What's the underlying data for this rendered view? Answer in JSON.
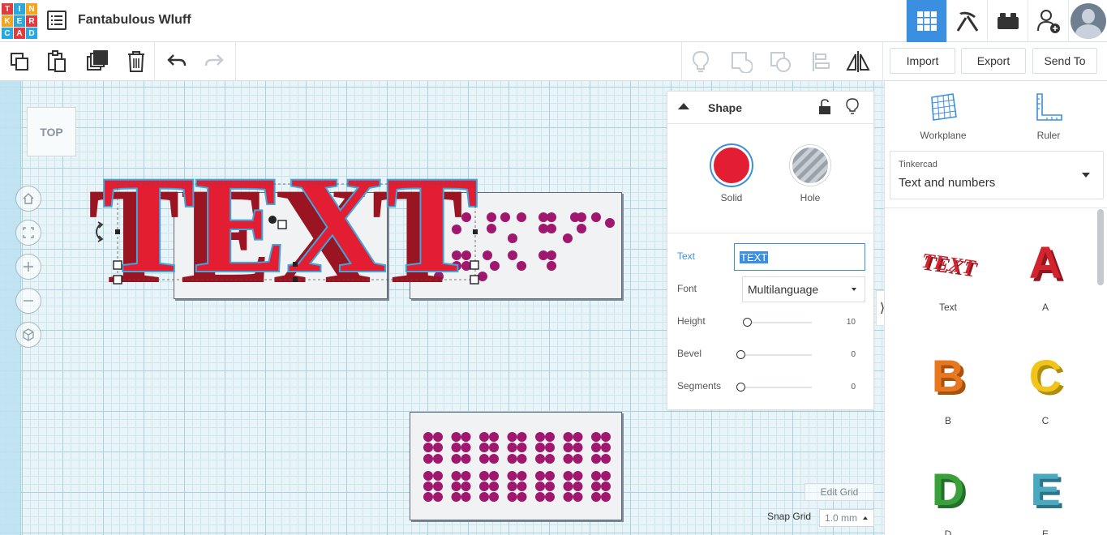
{
  "app": {
    "logo_letters": [
      "T",
      "I",
      "N",
      "K",
      "E",
      "R",
      "C",
      "A",
      "D"
    ],
    "logo_colors": [
      "#e23a3e",
      "#27a8e0",
      "#f7a31c",
      "#f7a31c",
      "#27a8e0",
      "#e23a3e",
      "#27a8e0",
      "#e23a3e",
      "#27a8e0"
    ],
    "design_title": "Fantabulous Wluff"
  },
  "topnav": {
    "items": [
      {
        "name": "3d-design-view",
        "icon": "grid-icon",
        "active": true
      },
      {
        "name": "codeblocks",
        "icon": "pickaxe-icon",
        "active": false
      },
      {
        "name": "bricks",
        "icon": "brick-icon",
        "active": false
      },
      {
        "name": "invite-people",
        "icon": "add-person-icon",
        "active": false
      }
    ],
    "accent_color": "#3b8fe0"
  },
  "toolbar": {
    "import_label": "Import",
    "export_label": "Export",
    "sendto_label": "Send To"
  },
  "viewport": {
    "viewcube_label": "TOP",
    "edit_grid_label": "Edit Grid",
    "snap_grid_label": "Snap Grid",
    "snap_grid_value": "1.0 mm",
    "text_object": "TEXT",
    "object_color": "#e31e33",
    "dot_color": "#a0176e"
  },
  "inspector": {
    "title": "Shape",
    "solid_label": "Solid",
    "hole_label": "Hole",
    "solid_color": "#e31e33",
    "text_label": "Text",
    "text_value": "TEXT",
    "font_label": "Font",
    "font_value": "Multilanguage",
    "height_label": "Height",
    "height_value": "10",
    "height_fraction": 0.0,
    "bevel_label": "Bevel",
    "bevel_value": "0",
    "bevel_fraction": 0.0,
    "segments_label": "Segments",
    "segments_value": "0",
    "segments_fraction": 0.0
  },
  "rightpanel": {
    "workplane_label": "Workplane",
    "ruler_label": "Ruler",
    "library_source": "Tinkercad",
    "library_name": "Text and numbers",
    "shapes": [
      {
        "label": "Text",
        "color": "#d3232f"
      },
      {
        "label": "A",
        "color": "#d3232f"
      },
      {
        "label": "B",
        "color": "#e8781f"
      },
      {
        "label": "C",
        "color": "#f0c419"
      },
      {
        "label": "D",
        "color": "#3aa13a"
      },
      {
        "label": "E",
        "color": "#4aa8bf"
      }
    ]
  }
}
